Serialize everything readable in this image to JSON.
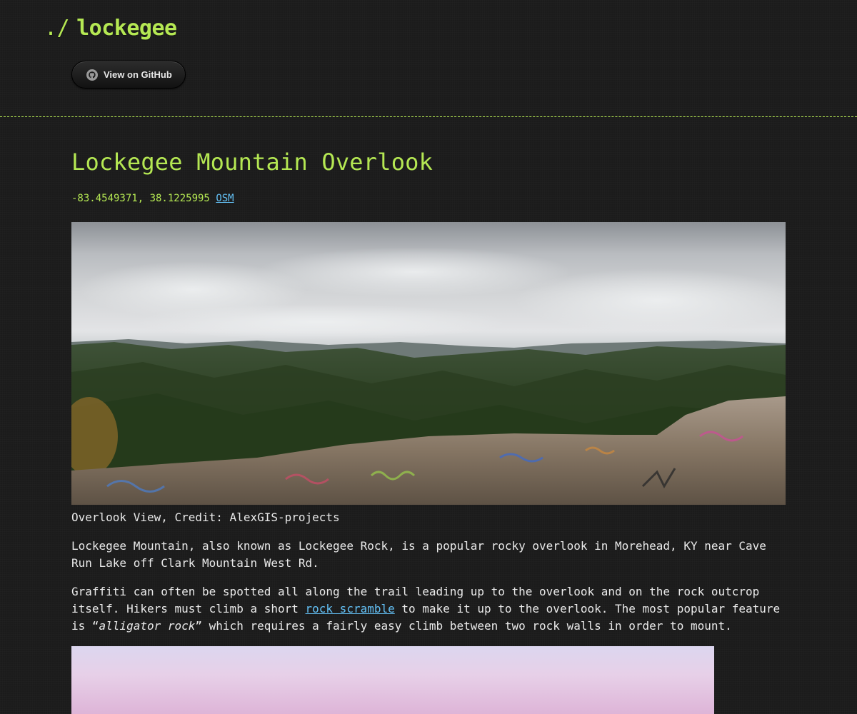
{
  "header": {
    "prompt": "./",
    "site_name": "lockegee",
    "github_button_label": "View on GitHub",
    "github_icon": "github-octocat-icon"
  },
  "main": {
    "title": "Lockegee Mountain Overlook",
    "coordinates": "-83.4549371, 38.1225995",
    "osm_link_label": "OSM",
    "photo_caption": "Overlook View, Credit: AlexGIS-projects",
    "paragraph1": "Lockegee Mountain, also known as Lockegee Rock, is a popular rocky overlook in Morehead, KY near Cave Run Lake off Clark Mountain West Rd.",
    "paragraph2": {
      "before_link": "Graffiti can often be spotted all along the trail leading up to the overlook and on the rock outcrop itself. Hikers must climb a short ",
      "link_text": "rock scramble",
      "after_link": " to make it up to the overlook. The most popular feature is “",
      "emphasis": "alligator rock",
      "end": "” which requires a fairly easy climb between two rock walls in order to mount."
    }
  },
  "colors": {
    "accent": "#b5e853",
    "link": "#63c0f5",
    "background": "#1b1b1b",
    "text": "#eaeaea"
  }
}
